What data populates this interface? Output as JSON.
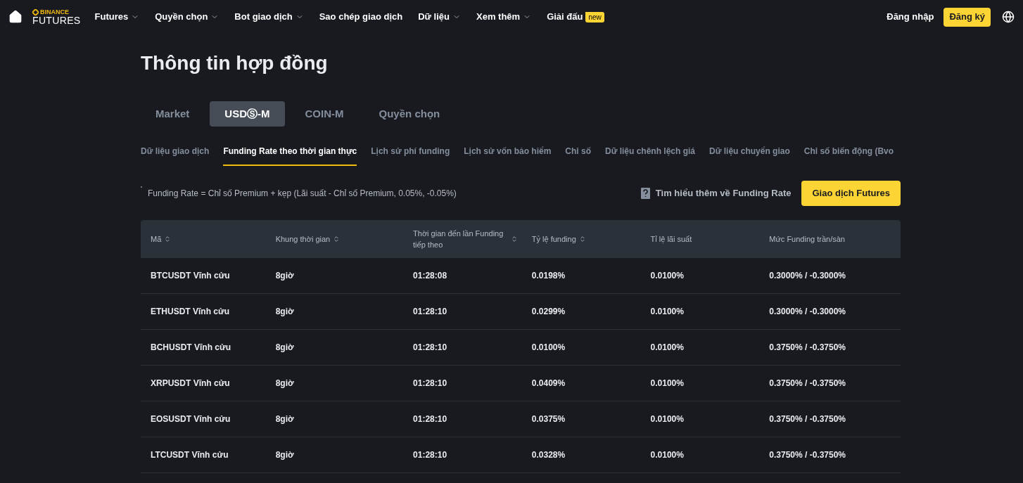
{
  "nav": {
    "logo_top": "BINANCE",
    "logo_bottom": "FUTURES",
    "items": [
      {
        "label": "Futures",
        "dropdown": true
      },
      {
        "label": "Quyền chọn",
        "dropdown": true
      },
      {
        "label": "Bot giao dịch",
        "dropdown": true
      },
      {
        "label": "Sao chép giao dịch",
        "dropdown": false
      },
      {
        "label": "Dữ liệu",
        "dropdown": true
      },
      {
        "label": "Xem thêm",
        "dropdown": true
      },
      {
        "label": "Giải đấu",
        "dropdown": false,
        "badge": "new"
      }
    ],
    "login": "Đăng nhập",
    "register": "Đăng ký"
  },
  "title": "Thông tin hợp đồng",
  "tabs": [
    {
      "label": "Market",
      "selected": false
    },
    {
      "label": "USDⓈ-M",
      "selected": true
    },
    {
      "label": "COIN-M",
      "selected": false
    },
    {
      "label": "Quyền chọn",
      "selected": false
    }
  ],
  "subtabs": [
    {
      "label": "Dữ liệu giao dịch",
      "selected": false
    },
    {
      "label": "Funding Rate theo thời gian thực",
      "selected": true
    },
    {
      "label": "Lịch sử phí funding",
      "selected": false
    },
    {
      "label": "Lịch sử vốn bảo hiểm",
      "selected": false
    },
    {
      "label": "Chỉ số",
      "selected": false
    },
    {
      "label": "Dữ liệu chênh lệch giá",
      "selected": false
    },
    {
      "label": "Dữ liệu chuyển giao",
      "selected": false
    },
    {
      "label": "Chỉ số biến động (Bvo",
      "selected": false
    }
  ],
  "formula": "Funding Rate = Chỉ số Premium + kẹp (Lãi suất - Chỉ số Premium, 0.05%, -0.05%)",
  "learn_more": "Tìm hiểu thêm về Funding Rate",
  "trade_button": "Giao dịch Futures",
  "table": {
    "columns": [
      {
        "label": "Mã",
        "sortable": true
      },
      {
        "label": "Khung thời gian",
        "sortable": true
      },
      {
        "label": "Thời gian đến lần Funding tiếp theo",
        "sortable": true
      },
      {
        "label": "Tỷ lệ funding",
        "sortable": true
      },
      {
        "label": "Tỉ lệ lãi suất",
        "sortable": false
      },
      {
        "label": "Mức Funding trần/sàn",
        "sortable": false
      }
    ],
    "rows": [
      [
        "BTCUSDT Vĩnh cửu",
        "8giờ",
        "01:28:08",
        "0.0198%",
        "0.0100%",
        "0.3000% / -0.3000%"
      ],
      [
        "ETHUSDT Vĩnh cửu",
        "8giờ",
        "01:28:10",
        "0.0299%",
        "0.0100%",
        "0.3000% / -0.3000%"
      ],
      [
        "BCHUSDT Vĩnh cửu",
        "8giờ",
        "01:28:10",
        "0.0100%",
        "0.0100%",
        "0.3750% / -0.3750%"
      ],
      [
        "XRPUSDT Vĩnh cửu",
        "8giờ",
        "01:28:10",
        "0.0409%",
        "0.0100%",
        "0.3750% / -0.3750%"
      ],
      [
        "EOSUSDT Vĩnh cửu",
        "8giờ",
        "01:28:10",
        "0.0375%",
        "0.0100%",
        "0.3750% / -0.3750%"
      ],
      [
        "LTCUSDT Vĩnh cửu",
        "8giờ",
        "01:28:10",
        "0.0328%",
        "0.0100%",
        "0.3750% / -0.3750%"
      ]
    ]
  }
}
